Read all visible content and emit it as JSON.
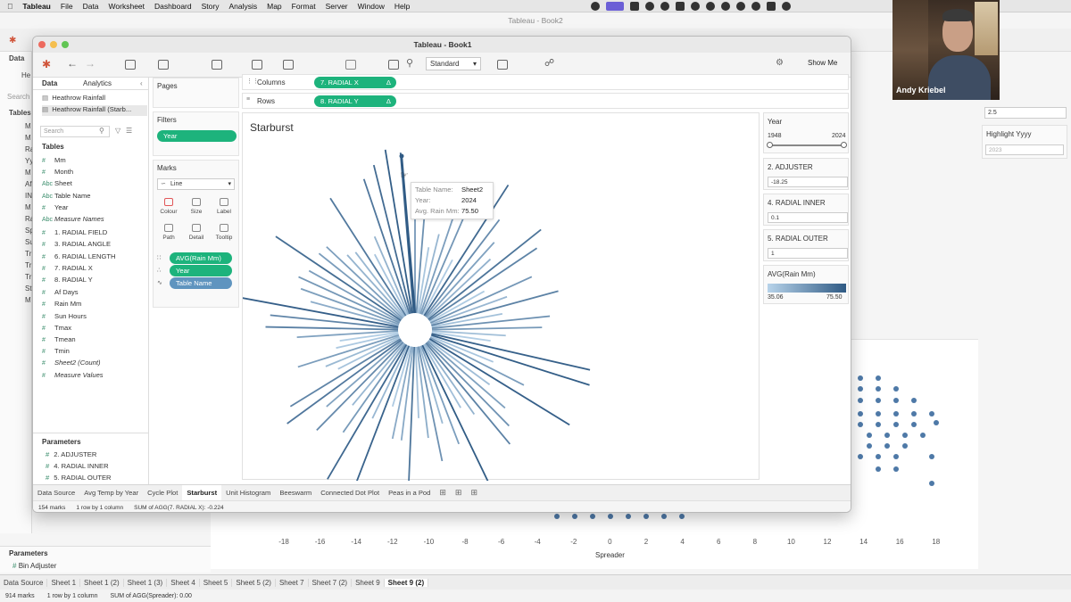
{
  "mac_menu": {
    "app": "Tableau",
    "items": [
      "File",
      "Data",
      "Worksheet",
      "Dashboard",
      "Story",
      "Analysis",
      "Map",
      "Format",
      "Server",
      "Window",
      "Help"
    ]
  },
  "bg_window": {
    "title": "Tableau - Book2",
    "pane_tab": "Data",
    "source_short": "He",
    "search_placeholder": "Search",
    "tables_label": "Tables",
    "field_initials": [
      "M",
      "M",
      "Ra",
      "Yy",
      "M",
      "Af",
      "IN",
      "M",
      "Ra",
      "Sp",
      "Su",
      "Tr",
      "Tr",
      "Tr",
      "St",
      "M"
    ],
    "right_value": "2.5",
    "highlight_label": "Highlight Yyyy",
    "highlight_value": "2023",
    "x_ticks": [
      "-18",
      "-16",
      "-14",
      "-12",
      "-10",
      "-8",
      "-6",
      "-4",
      "-2",
      "0",
      "2",
      "4",
      "6",
      "8",
      "10",
      "12",
      "14",
      "16",
      "18"
    ],
    "x_label": "Spreader",
    "parameters_label": "Parameters",
    "param_item": "Bin Adjuster",
    "tabs": [
      "Data Source",
      "Sheet 1",
      "Sheet 1 (2)",
      "Sheet 1 (3)",
      "Sheet 4",
      "Sheet 5",
      "Sheet 5 (2)",
      "Sheet 7",
      "Sheet 7 (2)",
      "Sheet 9",
      "Sheet 9 (2)"
    ],
    "status": [
      "914 marks",
      "1 row by 1 column",
      "SUM of AGG(Spreader): 0.00"
    ]
  },
  "window": {
    "title": "Tableau - Book1",
    "pane_tabs": {
      "data": "Data",
      "analytics": "Analytics"
    },
    "sources": [
      "Heathrow Rainfall",
      "Heathrow Rainfall (Starb..."
    ],
    "search_placeholder": "Search",
    "tables_label": "Tables",
    "fields": [
      {
        "icon": "#",
        "name": "Mm"
      },
      {
        "icon": "#",
        "name": "Month"
      },
      {
        "icon": "Abc",
        "name": "Sheet"
      },
      {
        "icon": "Abc",
        "name": "Table Name"
      },
      {
        "icon": "#",
        "name": "Year"
      },
      {
        "icon": "Abc",
        "name": "Measure Names"
      },
      {
        "icon": "#",
        "name": "1. RADIAL FIELD"
      },
      {
        "icon": "#",
        "name": "3. RADIAL ANGLE"
      },
      {
        "icon": "#",
        "name": "6. RADIAL LENGTH"
      },
      {
        "icon": "#",
        "name": "7. RADIAL X"
      },
      {
        "icon": "#",
        "name": "8. RADIAL Y"
      },
      {
        "icon": "#",
        "name": "Af Days"
      },
      {
        "icon": "#",
        "name": "Rain Mm"
      },
      {
        "icon": "#",
        "name": "Sun Hours"
      },
      {
        "icon": "#",
        "name": "Tmax"
      },
      {
        "icon": "#",
        "name": "Tmean"
      },
      {
        "icon": "#",
        "name": "Tmin"
      },
      {
        "icon": "#",
        "name": "Sheet2 (Count)"
      },
      {
        "icon": "#",
        "name": "Measure Values"
      }
    ],
    "parameters_label": "Parameters",
    "parameters": [
      "2. ADJUSTER",
      "4. RADIAL INNER",
      "5. RADIAL OUTER"
    ],
    "toolbar": {
      "fit": "Standard",
      "show_me": "Show Me"
    },
    "pages_label": "Pages",
    "filters_label": "Filters",
    "filter_pill": "Year",
    "marks_label": "Marks",
    "mark_type": "Line",
    "mark_buttons": [
      "Colour",
      "Size",
      "Label",
      "Path",
      "Detail",
      "Tooltip"
    ],
    "mark_pills": [
      "AVG(Rain Mm)",
      "Year",
      "Table Name"
    ],
    "columns_label": "Columns",
    "columns_pill": "7. RADIAL X",
    "rows_label": "Rows",
    "rows_pill": "8. RADIAL Y",
    "view_title": "Starburst",
    "tooltip": {
      "k1": "Table Name:",
      "v1": "Sheet2",
      "k2": "Year:",
      "v2": "2024",
      "k3": "Avg. Rain Mm:",
      "v3": "75.50"
    },
    "year_card": {
      "title": "Year",
      "min": "1948",
      "max": "2024"
    },
    "adjuster": {
      "title": "2. ADJUSTER",
      "value": "-18.25"
    },
    "radial_inner": {
      "title": "4. RADIAL INNER",
      "value": "0.1"
    },
    "radial_outer": {
      "title": "5. RADIAL OUTER",
      "value": "1"
    },
    "color_legend": {
      "title": "AVG(Rain Mm)",
      "min": "35.06",
      "max": "75.50"
    },
    "tabs": [
      "Data Source",
      "Avg Temp by Year",
      "Cycle Plot",
      "Starburst",
      "Unit Histogram",
      "Beeswarm",
      "Connected Dot Plot",
      "Peas in a Pod"
    ],
    "active_tab": "Starburst",
    "status": [
      "154 marks",
      "1 row by 1 column",
      "SUM of AGG(7. RADIAL X): -0.224"
    ]
  },
  "webcam": {
    "name": "Andy Kriebel"
  },
  "colors": {
    "accent": "#1db37c",
    "line_light": "#a9c8e0",
    "line_dark": "#2f5a84"
  }
}
